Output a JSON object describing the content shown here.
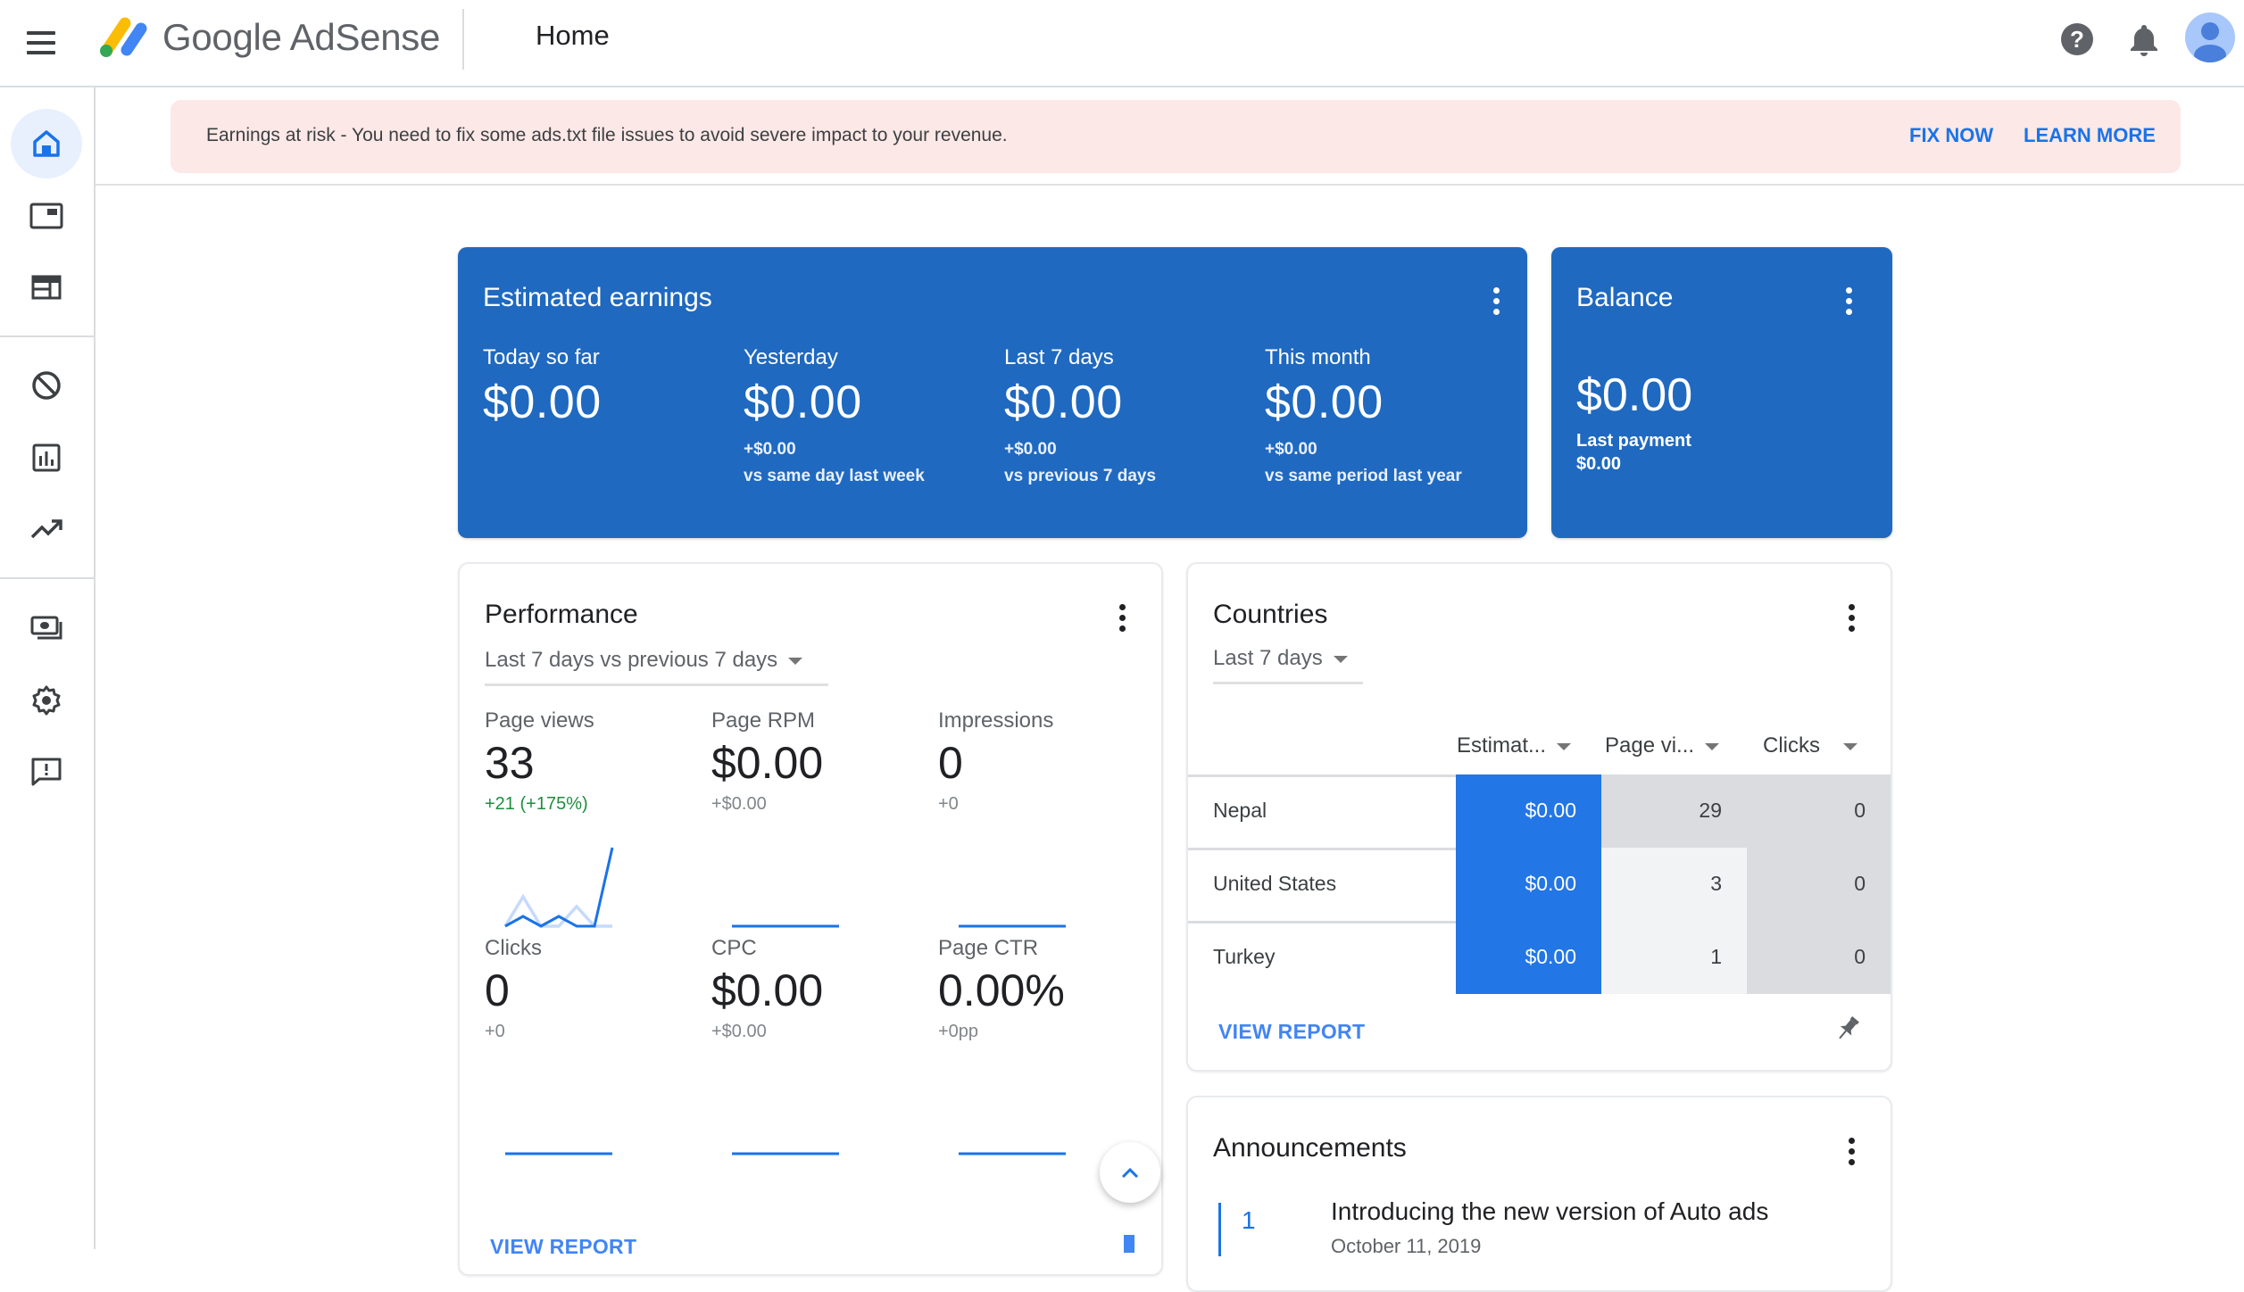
{
  "header": {
    "brand": "Google AdSense",
    "page_title": "Home",
    "icons": [
      "menu-icon",
      "help-icon",
      "notifications-icon",
      "account-avatar"
    ]
  },
  "sidebar": {
    "items": [
      {
        "name": "home",
        "icon": "home-icon",
        "active": true
      },
      {
        "name": "ads",
        "icon": "ads-icon",
        "active": false
      },
      {
        "name": "sites",
        "icon": "sites-icon",
        "active": false
      },
      {
        "name": "blocking-controls",
        "icon": "block-icon",
        "active": false
      },
      {
        "name": "reports",
        "icon": "bar-chart-icon",
        "active": false
      },
      {
        "name": "optimization",
        "icon": "trending-up-icon",
        "active": false
      },
      {
        "name": "payments",
        "icon": "payments-icon",
        "active": false
      },
      {
        "name": "account",
        "icon": "gear-icon",
        "active": false
      },
      {
        "name": "feedback",
        "icon": "feedback-icon",
        "active": false
      }
    ]
  },
  "alert": {
    "message": "Earnings at risk - You need to fix some ads.txt file issues to avoid severe impact to your revenue.",
    "fix_label": "FIX NOW",
    "learn_label": "LEARN MORE"
  },
  "earnings": {
    "title": "Estimated earnings",
    "metrics": [
      {
        "label": "Today so far",
        "value": "$0.00",
        "delta": "",
        "comparison": ""
      },
      {
        "label": "Yesterday",
        "value": "$0.00",
        "delta": "+$0.00",
        "comparison": "vs same day last week"
      },
      {
        "label": "Last 7 days",
        "value": "$0.00",
        "delta": "+$0.00",
        "comparison": "vs previous 7 days"
      },
      {
        "label": "This month",
        "value": "$0.00",
        "delta": "+$0.00",
        "comparison": "vs same period last year"
      }
    ]
  },
  "balance": {
    "title": "Balance",
    "value": "$0.00",
    "last_payment_label": "Last payment",
    "last_payment_value": "$0.00"
  },
  "performance": {
    "title": "Performance",
    "range": "Last 7 days vs previous 7 days",
    "metrics": [
      {
        "label": "Page views",
        "value": "33",
        "delta": "+21 (+175%)",
        "trend": "up",
        "series_current": [
          0,
          1,
          0,
          1,
          0,
          0,
          8
        ],
        "series_previous": [
          0,
          3,
          0,
          0,
          2,
          0,
          0
        ]
      },
      {
        "label": "Page RPM",
        "value": "$0.00",
        "delta": "+$0.00",
        "trend": "flat",
        "series_current": [
          0,
          0,
          0,
          0,
          0,
          0,
          0
        ]
      },
      {
        "label": "Impressions",
        "value": "0",
        "delta": "+0",
        "trend": "flat",
        "series_current": [
          0,
          0,
          0,
          0,
          0,
          0,
          0
        ]
      },
      {
        "label": "Clicks",
        "value": "0",
        "delta": "+0",
        "trend": "flat",
        "series_current": [
          0,
          0,
          0,
          0,
          0,
          0,
          0
        ]
      },
      {
        "label": "CPC",
        "value": "$0.00",
        "delta": "+$0.00",
        "trend": "flat",
        "series_current": [
          0,
          0,
          0,
          0,
          0,
          0,
          0
        ]
      },
      {
        "label": "Page CTR",
        "value": "0.00%",
        "delta": "+0pp",
        "trend": "flat",
        "series_current": [
          0,
          0,
          0,
          0,
          0,
          0,
          0
        ]
      }
    ],
    "view_report": "VIEW REPORT"
  },
  "countries": {
    "title": "Countries",
    "range": "Last 7 days",
    "columns": [
      "Estimat...",
      "Page vi...",
      "Clicks"
    ],
    "rows": [
      {
        "country": "Nepal",
        "earnings": "$0.00",
        "page_views": "29",
        "clicks": "0"
      },
      {
        "country": "United States",
        "earnings": "$0.00",
        "page_views": "3",
        "clicks": "0"
      },
      {
        "country": "Turkey",
        "earnings": "$0.00",
        "page_views": "1",
        "clicks": "0"
      }
    ],
    "view_report": "VIEW REPORT"
  },
  "announcements": {
    "title": "Announcements",
    "items": [
      {
        "index": "1",
        "title": "Introducing the new version of Auto ads",
        "date": "October 11, 2019"
      }
    ]
  },
  "colors": {
    "brand_blue": "#1f69c0",
    "accent_blue": "#1a73e8",
    "alert_bg": "#fce8e6",
    "positive_green": "#1e8e3e"
  }
}
